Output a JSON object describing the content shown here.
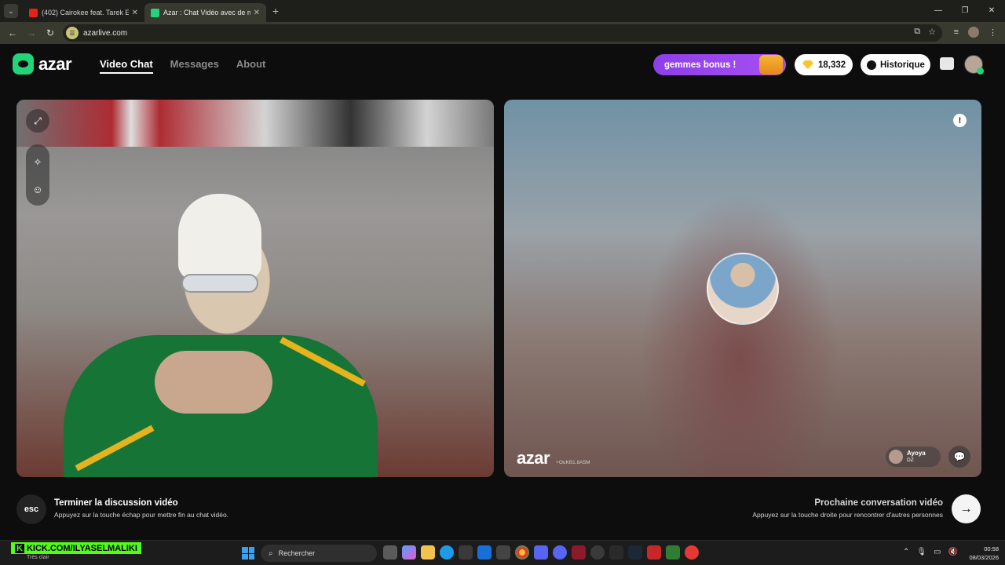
{
  "browser": {
    "tabs": [
      {
        "title": "(402) Cairokee feat. Tarek El-Sh",
        "favicon_color": "#e62117",
        "active": false
      },
      {
        "title": "Azar : Chat Vidéo avec de n",
        "favicon_color": "#23d37a",
        "active": true
      }
    ],
    "url": "azarlive.com"
  },
  "app": {
    "logo": "azar",
    "nav": {
      "video_chat": "Video Chat",
      "messages": "Messages",
      "about": "About"
    },
    "bonus_label": "gemmes bonus !",
    "gems_count": "18,332",
    "history_label": "Historique"
  },
  "right_panel": {
    "watermark_logo": "azar",
    "watermark_id": "+OuKB1.8A5M",
    "peer_name": "Ayoya",
    "peer_country": "DZ"
  },
  "footer": {
    "esc_key": "esc",
    "end_title": "Terminer la discussion vidéo",
    "end_sub": "Appuyez sur la touche échap pour mettre fin au chat vidéo.",
    "next_title": "Prochaine conversation vidéo",
    "next_sub": "Appuyez sur la touche droite pour rencontrer d'autres personnes"
  },
  "taskbar": {
    "kick_banner": "KICK.COM/ILYASELMALIKI",
    "weather": "Très clair",
    "search_placeholder": "Rechercher",
    "time": "00:58",
    "date": "08/03/2026"
  },
  "colors": {
    "accent": "#23d37a",
    "bonus": "#a64ff0",
    "gem": "#f7c52a"
  }
}
